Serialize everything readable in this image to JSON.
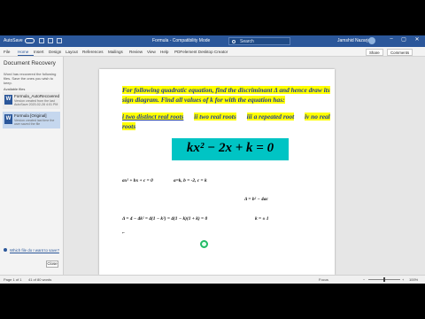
{
  "window": {
    "autosave_label": "AutoSave",
    "autosave_state": "Off",
    "title": "Formula - Compatibility Mode",
    "search_placeholder": "Search",
    "user_name": "Jamshid Nazarjon"
  },
  "ribbon": {
    "tabs": [
      "File",
      "Home",
      "Insert",
      "Design",
      "Layout",
      "References",
      "Mailings",
      "Review",
      "View",
      "Help",
      "PDFelement Desktop Creator"
    ],
    "active_tab": "Home",
    "share_label": "Share",
    "comments_label": "Comments"
  },
  "recovery": {
    "title": "Document Recovery",
    "message": "Word has recovered the following files. Save the ones you wish to keep.",
    "available_label": "Available files",
    "files": [
      {
        "name": "Formula_AutoRecovered",
        "desc": "Version created from the last AutoSave 2020-02-28 4:01 PM"
      },
      {
        "name": "Formula [Original]",
        "desc": "Version created last time the user saved the file"
      }
    ],
    "help_link": "Which file do I want to save?",
    "close_label": "Close"
  },
  "document": {
    "problem_line1": "For following quadratic equation, find the discriminant  Δ and hence draw its",
    "problem_line2": "sign diagram. Find all values of k for with the equation has:",
    "problem_line3a": "i  two distinct real roots",
    "problem_line3b": "ii two real roots",
    "problem_line3c": "iii a repeated root",
    "problem_line3d": "iv no real",
    "problem_line4": "roots",
    "equation": "kx² − 2x + k = 0",
    "work_general": "ax² + bx + c = 0",
    "work_coeffs": "a=k, b = -2, c = k",
    "work_delta_def": "Δ  =  b² − 4ac",
    "work_delta_calc": "Δ  =  4 − 4k² = 4(1 − k²) = 4(1 − k)(1 + k) = 0",
    "work_roots": "k = ± 1"
  },
  "status": {
    "page": "Page 1 of 1",
    "words": "41 of 80 words",
    "focus": "Focus",
    "zoom": "100%"
  },
  "colors": {
    "accent": "#2b579a",
    "highlight": "#ffff00",
    "equation_bg": "#00c4c4",
    "problem_text": "#1f3d99"
  }
}
